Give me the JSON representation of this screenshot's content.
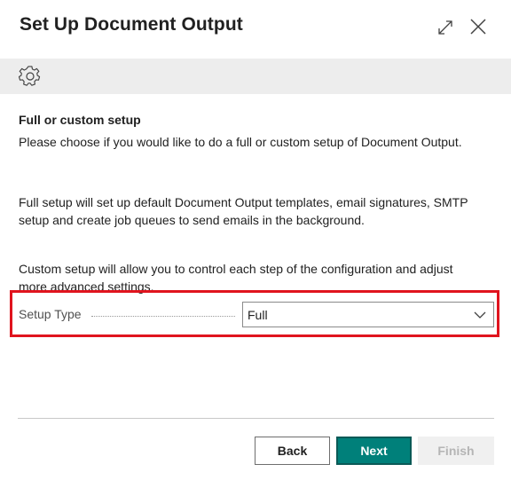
{
  "dialog": {
    "title": "Set Up Document Output",
    "expand_icon": "expand-diagonal-icon",
    "close_icon": "close-icon"
  },
  "action_bar": {
    "settings_icon": "gear-icon"
  },
  "content": {
    "heading": "Full or custom setup",
    "intro": "Please choose if you would like to do a full or custom setup of Document Output.",
    "full_description": "Full setup will set up default Document Output templates, email signatures, SMTP setup and create job queues to send emails in the background.",
    "custom_description": "Custom setup will allow you to control each step of the configuration and adjust more advanced settings."
  },
  "setup_type": {
    "label": "Setup Type",
    "value": "Full"
  },
  "footer": {
    "back_label": "Back",
    "next_label": "Next",
    "finish_label": "Finish"
  },
  "colors": {
    "primary": "#00807a",
    "highlight": "#e0141e",
    "action_bar": "#ededed"
  }
}
